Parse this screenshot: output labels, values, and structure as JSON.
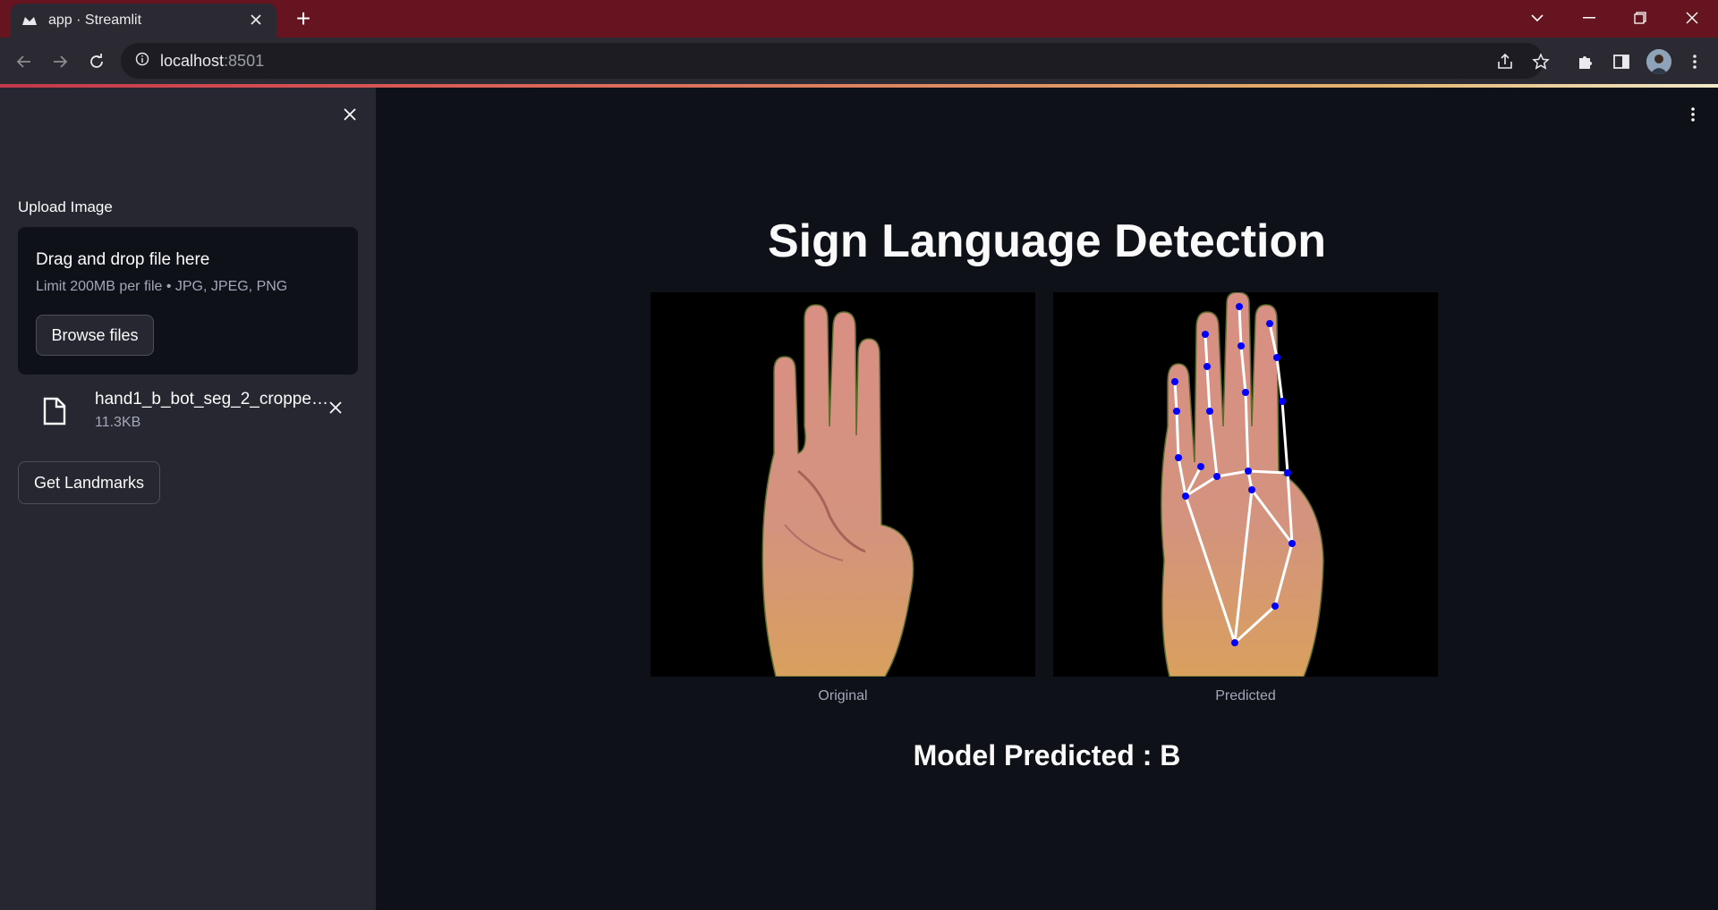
{
  "browser": {
    "tab_title": "app · Streamlit",
    "new_tab_symbol": "+",
    "url_host": "localhost",
    "url_port": ":8501"
  },
  "sidebar": {
    "upload_label": "Upload Image",
    "dropzone_title": "Drag and drop file here",
    "dropzone_limit": "Limit 200MB per file • JPG, JPEG, PNG",
    "browse_button": "Browse files",
    "file": {
      "name": "hand1_b_bot_seg_2_cropped.jpeg",
      "size": "11.3KB"
    },
    "landmarks_button": "Get Landmarks"
  },
  "main": {
    "title": "Sign Language Detection",
    "images": [
      {
        "caption": "Original"
      },
      {
        "caption": "Predicted"
      }
    ],
    "prediction": "Model Predicted : B"
  },
  "colors": {
    "titlebar": "#661420",
    "sidebar": "#262730",
    "main_bg": "#0e1117",
    "landmark_point": "#0000ff",
    "landmark_line": "#ffffff"
  },
  "icons": [
    "streamlit-favicon",
    "close-icon",
    "back-arrow-icon",
    "forward-arrow-icon",
    "reload-icon",
    "info-icon",
    "share-icon",
    "star-icon",
    "extension-icon",
    "side-panel-icon",
    "kebab-menu-icon",
    "file-icon"
  ]
}
